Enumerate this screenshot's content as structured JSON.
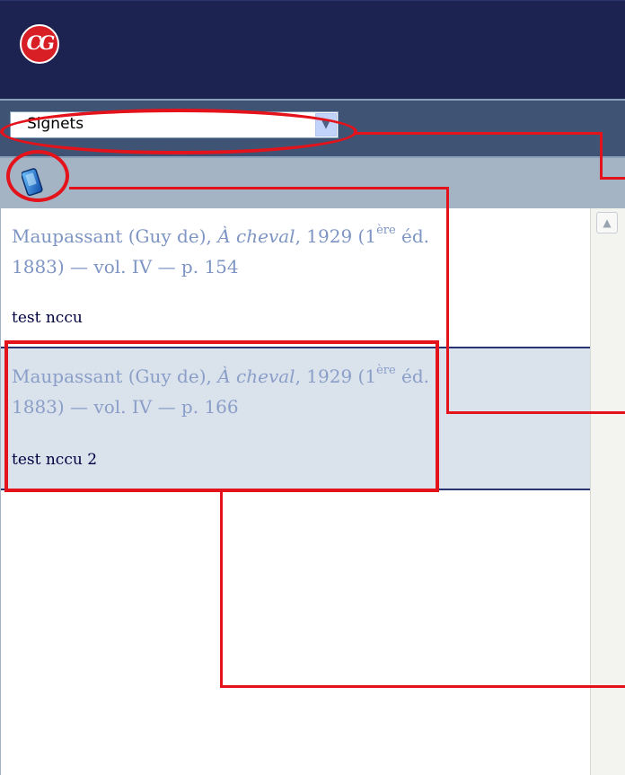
{
  "header": {
    "logo_text": "CG"
  },
  "toolbar": {
    "select_value": "Signets",
    "select_arrow_icon": "chevron-down-icon"
  },
  "iconbar": {
    "icon": "bookmark-device-icon"
  },
  "bookmarks": [
    {
      "author": "Maupassant (Guy de), ",
      "title": "À cheval",
      "year_part": ", 1929 (1",
      "sup": "ère",
      "edition_rest": " éd.",
      "line2": "1883) — vol. IV — p. 154",
      "note": "test nccu"
    },
    {
      "author": "Maupassant (Guy de), ",
      "title": "À cheval",
      "year_part": ", 1929 (1",
      "sup": "ère",
      "edition_rest": " éd.",
      "line2": "1883) — vol. IV — p. 166",
      "note": "test nccu 2"
    }
  ],
  "scrollbar": {
    "up_icon": "scroll-up-arrow-icon"
  },
  "colors": {
    "header": "#1c2350",
    "toolbar": "#3f5474",
    "iconbar": "#a4b4c4",
    "selected_row": "#dae2ec",
    "annotation": "#e3121b",
    "link_text": "#7e95c4"
  }
}
